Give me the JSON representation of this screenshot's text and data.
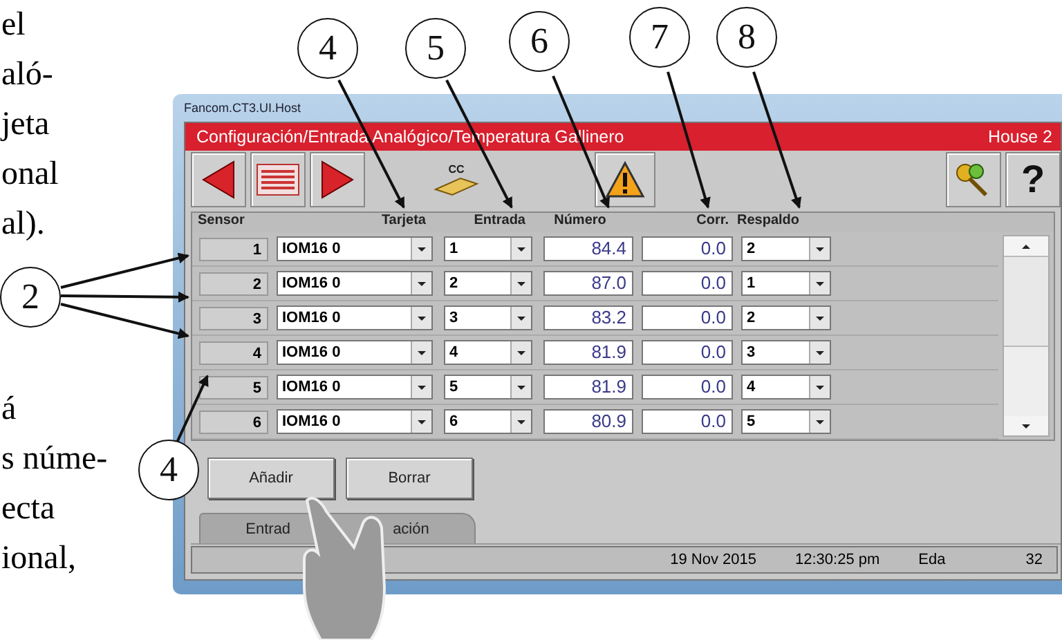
{
  "page_text_fragments": {
    "top": [
      "el",
      "aló-",
      "jeta",
      "onal",
      "al)."
    ],
    "bottom": [
      "á",
      "s núme-",
      "ecta",
      "ional,"
    ]
  },
  "callouts": [
    {
      "number": "4"
    },
    {
      "number": "5"
    },
    {
      "number": "6"
    },
    {
      "number": "7"
    },
    {
      "number": "8"
    }
  ],
  "side_callouts": [
    {
      "number": "2"
    },
    {
      "number": "4"
    }
  ],
  "window": {
    "title": "Fancom.CT3.UI.Host"
  },
  "header": {
    "path": "Configuración/Entrada Analógico/Temperatura Gallinero",
    "house": "House 2"
  },
  "toolbar": {
    "cc_label": "CC",
    "help": "?"
  },
  "table": {
    "columns": [
      "Sensor",
      "Tarjeta",
      "Entrada",
      "Número",
      "Corr.",
      "Respaldo"
    ],
    "rows": [
      {
        "sensor": "1",
        "tarjeta": "IOM16 0",
        "entrada": "1",
        "numero": "84.4",
        "corr": "0.0",
        "respaldo": "2"
      },
      {
        "sensor": "2",
        "tarjeta": "IOM16 0",
        "entrada": "2",
        "numero": "87.0",
        "corr": "0.0",
        "respaldo": "1"
      },
      {
        "sensor": "3",
        "tarjeta": "IOM16 0",
        "entrada": "3",
        "numero": "83.2",
        "corr": "0.0",
        "respaldo": "2"
      },
      {
        "sensor": "4",
        "tarjeta": "IOM16 0",
        "entrada": "4",
        "numero": "81.9",
        "corr": "0.0",
        "respaldo": "3"
      },
      {
        "sensor": "5",
        "tarjeta": "IOM16 0",
        "entrada": "5",
        "numero": "81.9",
        "corr": "0.0",
        "respaldo": "4"
      },
      {
        "sensor": "6",
        "tarjeta": "IOM16 0",
        "entrada": "6",
        "numero": "80.9",
        "corr": "0.0",
        "respaldo": "5"
      }
    ]
  },
  "buttons": [
    "Añadir",
    "Borrar"
  ],
  "tabs": [
    {
      "label_parts": [
        "Entrad",
        "ación"
      ],
      "selected": true
    }
  ],
  "status_bar": {
    "date": "19 Nov 2015",
    "time": "12:30:25 pm",
    "user": "Eda",
    "number": "32"
  }
}
